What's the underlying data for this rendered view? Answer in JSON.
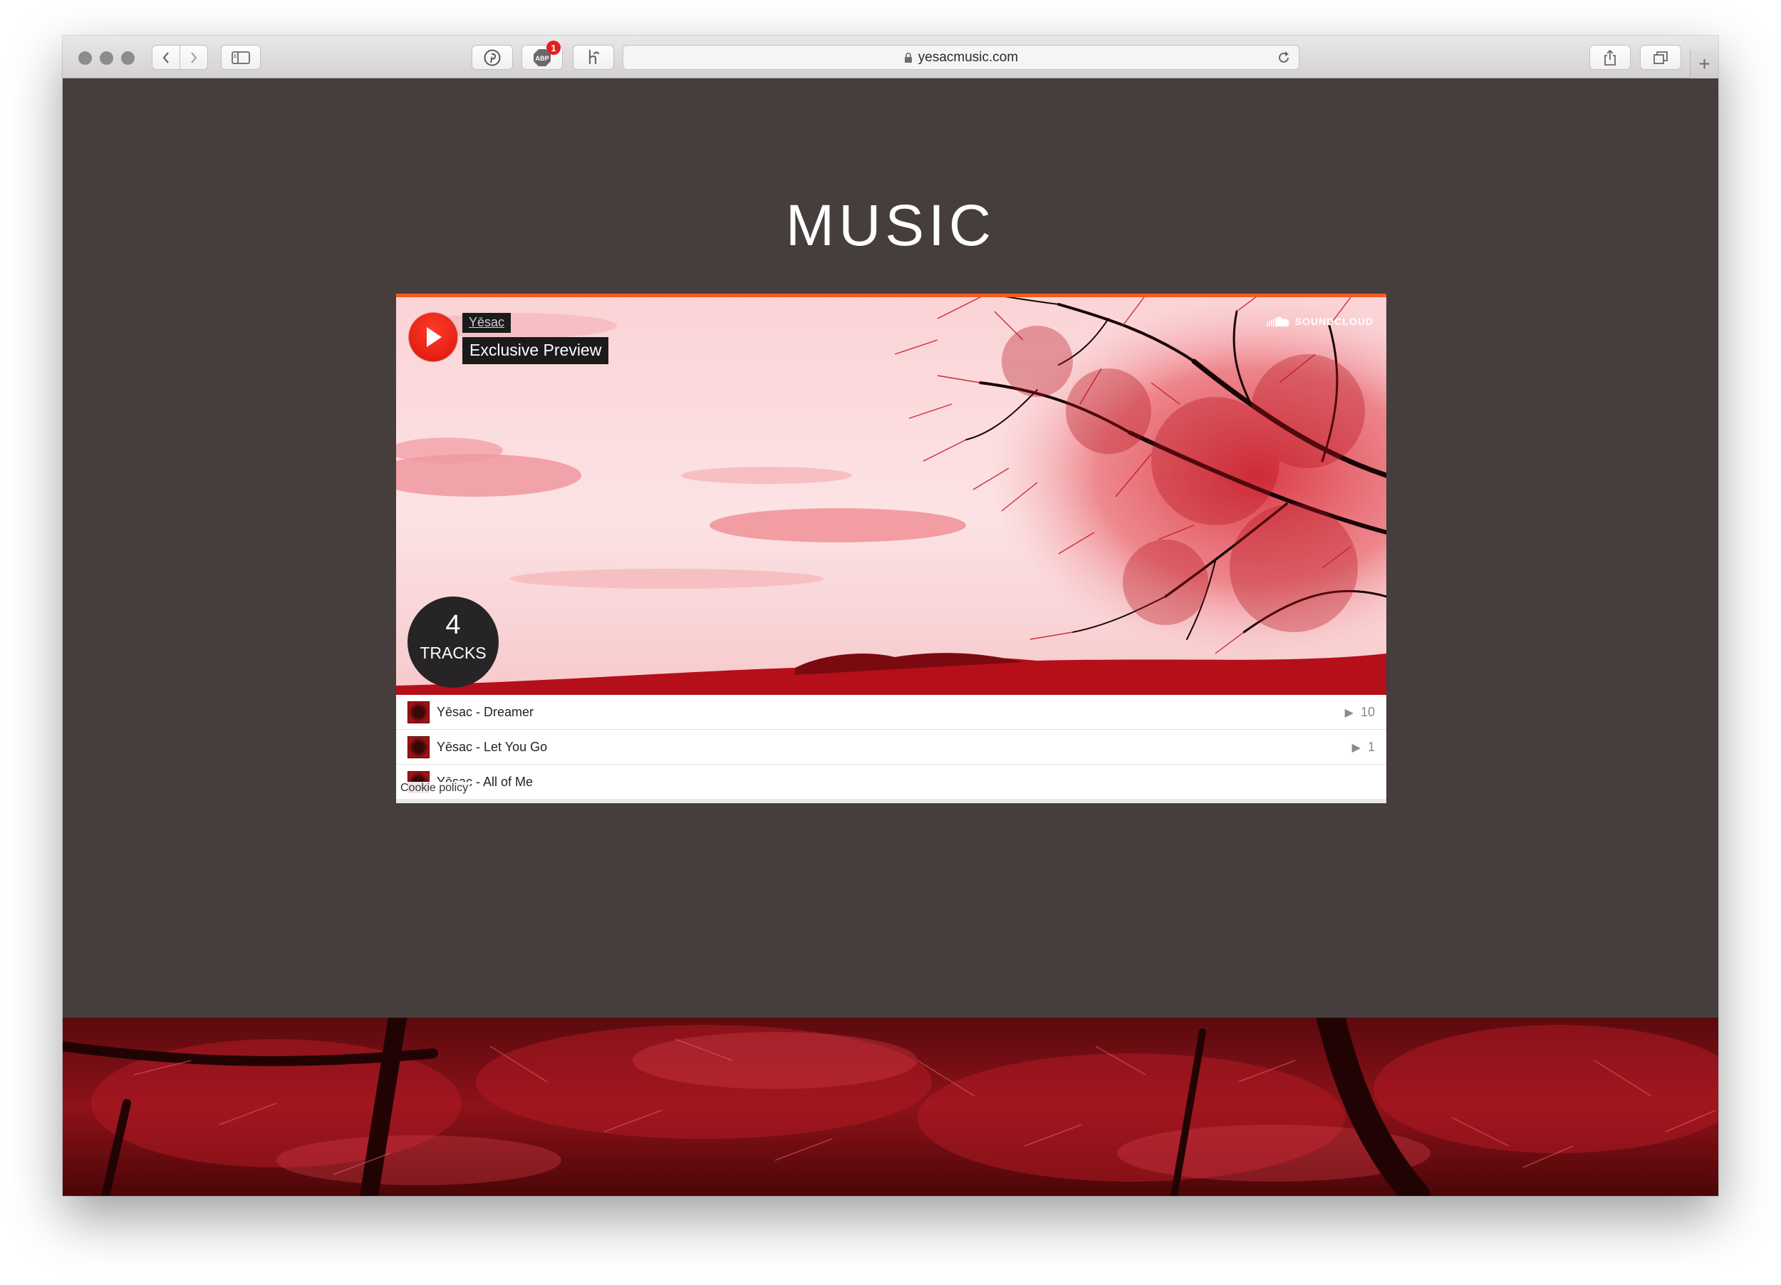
{
  "browser": {
    "url": "yesacmusic.com",
    "abp_label": "ABP",
    "abp_badge_count": "1"
  },
  "page": {
    "title": "MUSIC"
  },
  "player": {
    "artist": "Yēsac",
    "playlist_title": "Exclusive Preview",
    "brand": "SOUNDCLOUD",
    "track_count": "4",
    "track_count_label": "TRACKS",
    "tracks": [
      {
        "title": "Yēsac - Dreamer",
        "plays": "10"
      },
      {
        "title": "Yēsac - Let You Go",
        "plays": "1"
      },
      {
        "title": "Yēsac - All of Me",
        "plays": ""
      }
    ],
    "cookie_policy": "Cookie policy"
  },
  "colors": {
    "page_background": "#463d3d",
    "accent": "#f25a21",
    "play_button": "#e0180d",
    "artwork_tint": "#d8202a"
  },
  "icons": {
    "back": "chevron-left-icon",
    "forward": "chevron-right-icon",
    "sidebar": "sidebar-icon",
    "pinterest": "pinterest-icon",
    "adblock": "adblock-icon",
    "extension": "honey-icon",
    "lock": "lock-icon",
    "reload": "reload-icon",
    "share": "share-icon",
    "tabs": "tabs-icon",
    "new_tab": "plus-icon",
    "play": "play-icon",
    "soundcloud": "soundcloud-icon"
  }
}
